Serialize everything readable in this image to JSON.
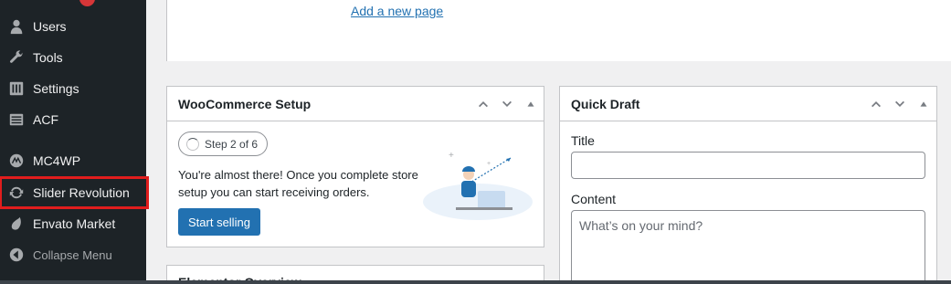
{
  "sidebar": {
    "items": [
      {
        "label": "Users",
        "icon": "user-icon"
      },
      {
        "label": "Tools",
        "icon": "wrench-icon"
      },
      {
        "label": "Settings",
        "icon": "settings-icon"
      },
      {
        "label": "ACF",
        "icon": "acf-icon"
      },
      {
        "label": "MC4WP",
        "icon": "mc4wp-icon"
      },
      {
        "label": "Slider Revolution",
        "icon": "refresh-icon"
      },
      {
        "label": "Envato Market",
        "icon": "leaf-icon"
      },
      {
        "label": "Collapse Menu",
        "icon": "collapse-icon"
      }
    ]
  },
  "top_panel": {
    "add_link": "Add a new page"
  },
  "woocommerce": {
    "title": "WooCommerce Setup",
    "step": "Step 2 of 6",
    "text": "You're almost there! Once you complete store setup you can start receiving orders.",
    "button": "Start selling"
  },
  "quick_draft": {
    "title": "Quick Draft",
    "title_label": "Title",
    "content_label": "Content",
    "content_placeholder": "What’s on your mind?"
  },
  "partial_widget": {
    "title": "Elementor Overview"
  },
  "colors": {
    "sidebar": "#1d2327",
    "accent": "#2271b1",
    "highlight": "#e11d1d"
  }
}
